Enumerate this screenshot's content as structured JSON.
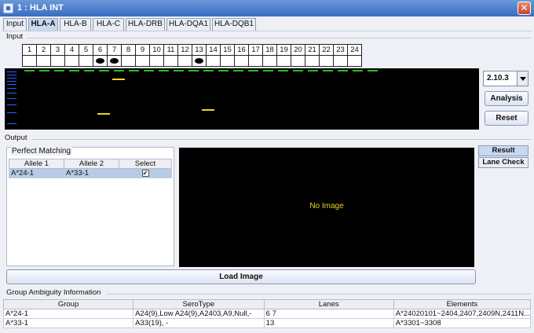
{
  "window": {
    "title": "1 : HLA INT",
    "close_glyph": "✕"
  },
  "tabs": [
    {
      "label": "Input",
      "active": false
    },
    {
      "label": "HLA-A",
      "active": true
    },
    {
      "label": "HLA-B",
      "active": false
    },
    {
      "label": "HLA-C",
      "active": false
    },
    {
      "label": "HLA-DRB",
      "active": false
    },
    {
      "label": "HLA-DQA1",
      "active": false
    },
    {
      "label": "HLA-DQB1",
      "active": false
    }
  ],
  "input": {
    "section_label": "Input",
    "lanes": [
      "1",
      "2",
      "3",
      "4",
      "5",
      "6",
      "7",
      "8",
      "9",
      "10",
      "11",
      "12",
      "13",
      "14",
      "15",
      "16",
      "17",
      "18",
      "19",
      "20",
      "21",
      "22",
      "23",
      "24"
    ],
    "marked_lanes": [
      6,
      7,
      13
    ],
    "version": "2.10.3",
    "analysis_label": "Analysis",
    "reset_label": "Reset",
    "colors": {
      "control_band": "#22c422",
      "sample_band": "#e8d820",
      "ladder": "#2563ff"
    }
  },
  "output": {
    "section_label": "Output",
    "perfect_matching": {
      "title": "Perfect Matching",
      "columns": [
        "Allele 1",
        "Allele 2",
        "Select"
      ],
      "rows": [
        {
          "allele1": "A*24-1",
          "allele2": "A*33-1",
          "selected": "✔"
        }
      ]
    },
    "image_placeholder": "No Image",
    "side_tabs": [
      "Result",
      "Lane Check"
    ],
    "load_image_label": "Load Image"
  },
  "group_ambiguity": {
    "title": "Group Ambiguity Information",
    "columns": [
      "Group",
      "SeroType",
      "Lanes",
      "Elements"
    ],
    "rows": [
      {
        "group": "A*24-1",
        "serotype": "A24(9),Low A24(9),A2403,A9,Null,-",
        "lanes": "6 7",
        "elements": "A*24020101~2404,2407,2409N,2411N..."
      },
      {
        "group": "A*33-1",
        "serotype": "A33(19), -",
        "lanes": "13",
        "elements": "A*3301~3308"
      }
    ]
  }
}
